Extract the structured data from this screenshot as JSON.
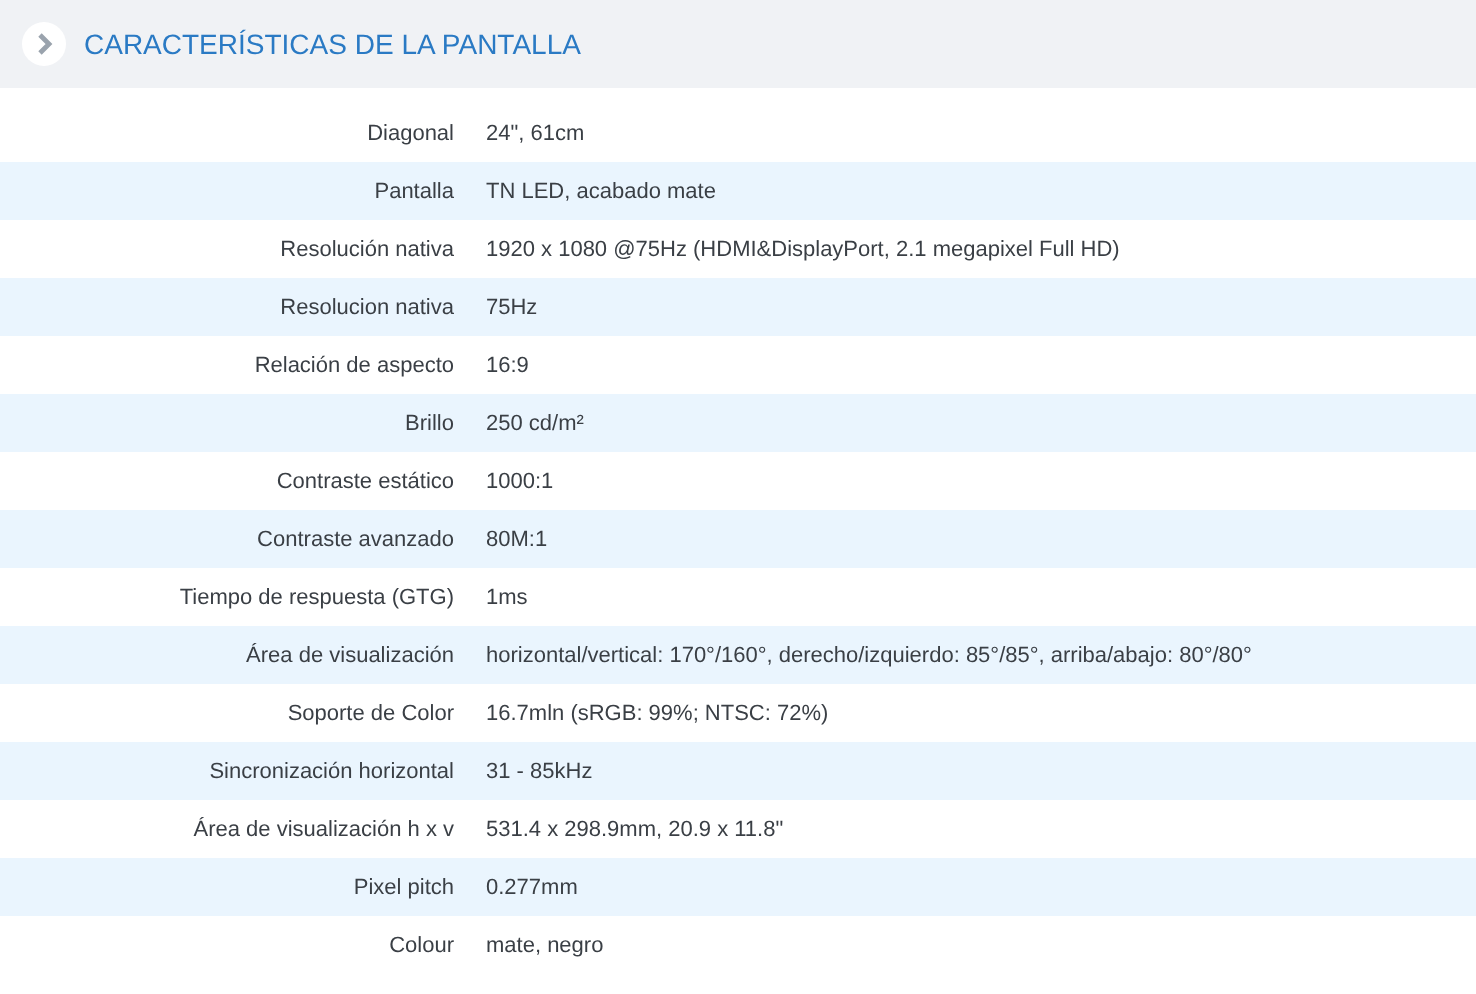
{
  "section": {
    "title": "CARACTERÍSTICAS DE LA PANTALLA"
  },
  "specs": [
    {
      "label": "Diagonal",
      "value": "24\", 61cm"
    },
    {
      "label": "Pantalla",
      "value": "TN LED, acabado mate"
    },
    {
      "label": "Resolución nativa",
      "value": "1920 x 1080 @75Hz (HDMI&DisplayPort, 2.1 megapixel Full HD)"
    },
    {
      "label": "Resolucion nativa",
      "value": "75Hz"
    },
    {
      "label": "Relación de aspecto",
      "value": "16:9"
    },
    {
      "label": "Brillo",
      "value": "250 cd/m²"
    },
    {
      "label": "Contraste estático",
      "value": "1000:1"
    },
    {
      "label": "Contraste avanzado",
      "value": "80M:1"
    },
    {
      "label": "Tiempo de respuesta (GTG)",
      "value": "1ms"
    },
    {
      "label": "Área de visualización",
      "value": "horizontal/vertical: 170°/160°, derecho/izquierdo: 85°/85°, arriba/abajo: 80°/80°"
    },
    {
      "label": "Soporte de Color",
      "value": "16.7mln (sRGB: 99%; NTSC: 72%)"
    },
    {
      "label": "Sincronización horizontal",
      "value": "31 - 85kHz"
    },
    {
      "label": "Área de visualización h x v",
      "value": "531.4 x 298.9mm, 20.9 x 11.8\""
    },
    {
      "label": "Pixel pitch",
      "value": "0.277mm"
    },
    {
      "label": "Colour",
      "value": "mate, negro"
    }
  ]
}
